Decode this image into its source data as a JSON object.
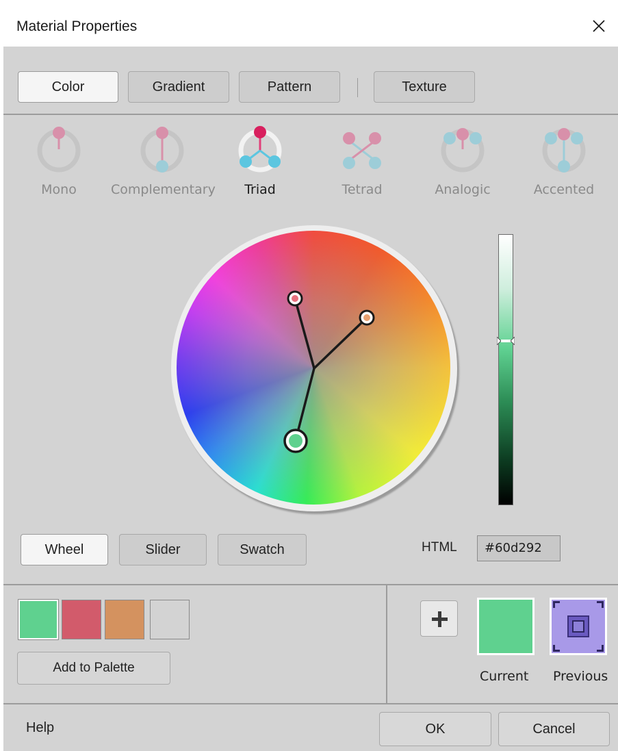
{
  "window": {
    "title": "Material Properties",
    "close_icon": "close-icon"
  },
  "fill_tabs": [
    {
      "label": "Color",
      "active": true
    },
    {
      "label": "Gradient",
      "active": false
    },
    {
      "label": "Pattern",
      "active": false
    },
    {
      "label": "Texture",
      "active": false
    }
  ],
  "harmony_schemes": [
    {
      "label": "Mono",
      "icon": "mono-harmony-icon",
      "active": false
    },
    {
      "label": "Complementary",
      "icon": "complementary-harmony-icon",
      "active": false
    },
    {
      "label": "Triad",
      "icon": "triad-harmony-icon",
      "active": true
    },
    {
      "label": "Tetrad",
      "icon": "tetrad-harmony-icon",
      "active": false
    },
    {
      "label": "Analogic",
      "icon": "analogic-harmony-icon",
      "active": false
    },
    {
      "label": "Accented",
      "icon": "accented-harmony-icon",
      "active": false
    }
  ],
  "picker_modes": [
    {
      "label": "Wheel",
      "active": true
    },
    {
      "label": "Slider",
      "active": false
    },
    {
      "label": "Swatch",
      "active": false
    }
  ],
  "html_color": {
    "label": "HTML",
    "value": "#60d292"
  },
  "palette": {
    "swatches": [
      "#5fd18f",
      "#d25b6b",
      "#d4925f",
      "#d3d3d3"
    ],
    "add_label": "Add to Palette",
    "add_icon": "plus-icon"
  },
  "current_color": {
    "label": "Current",
    "color": "#5fd18f"
  },
  "previous_color": {
    "label": "Previous",
    "color": "#a899e8"
  },
  "footer": {
    "help_label": "Help",
    "ok_label": "OK",
    "cancel_label": "Cancel"
  },
  "colors": {
    "dialog_bg": "#d3d3d3",
    "harmony_primary": "#e0407a",
    "harmony_secondary": "#5cc6e0",
    "handle_primary": "#5fd18f",
    "handle_red": "#e8707e",
    "handle_orange": "#e8a070"
  }
}
